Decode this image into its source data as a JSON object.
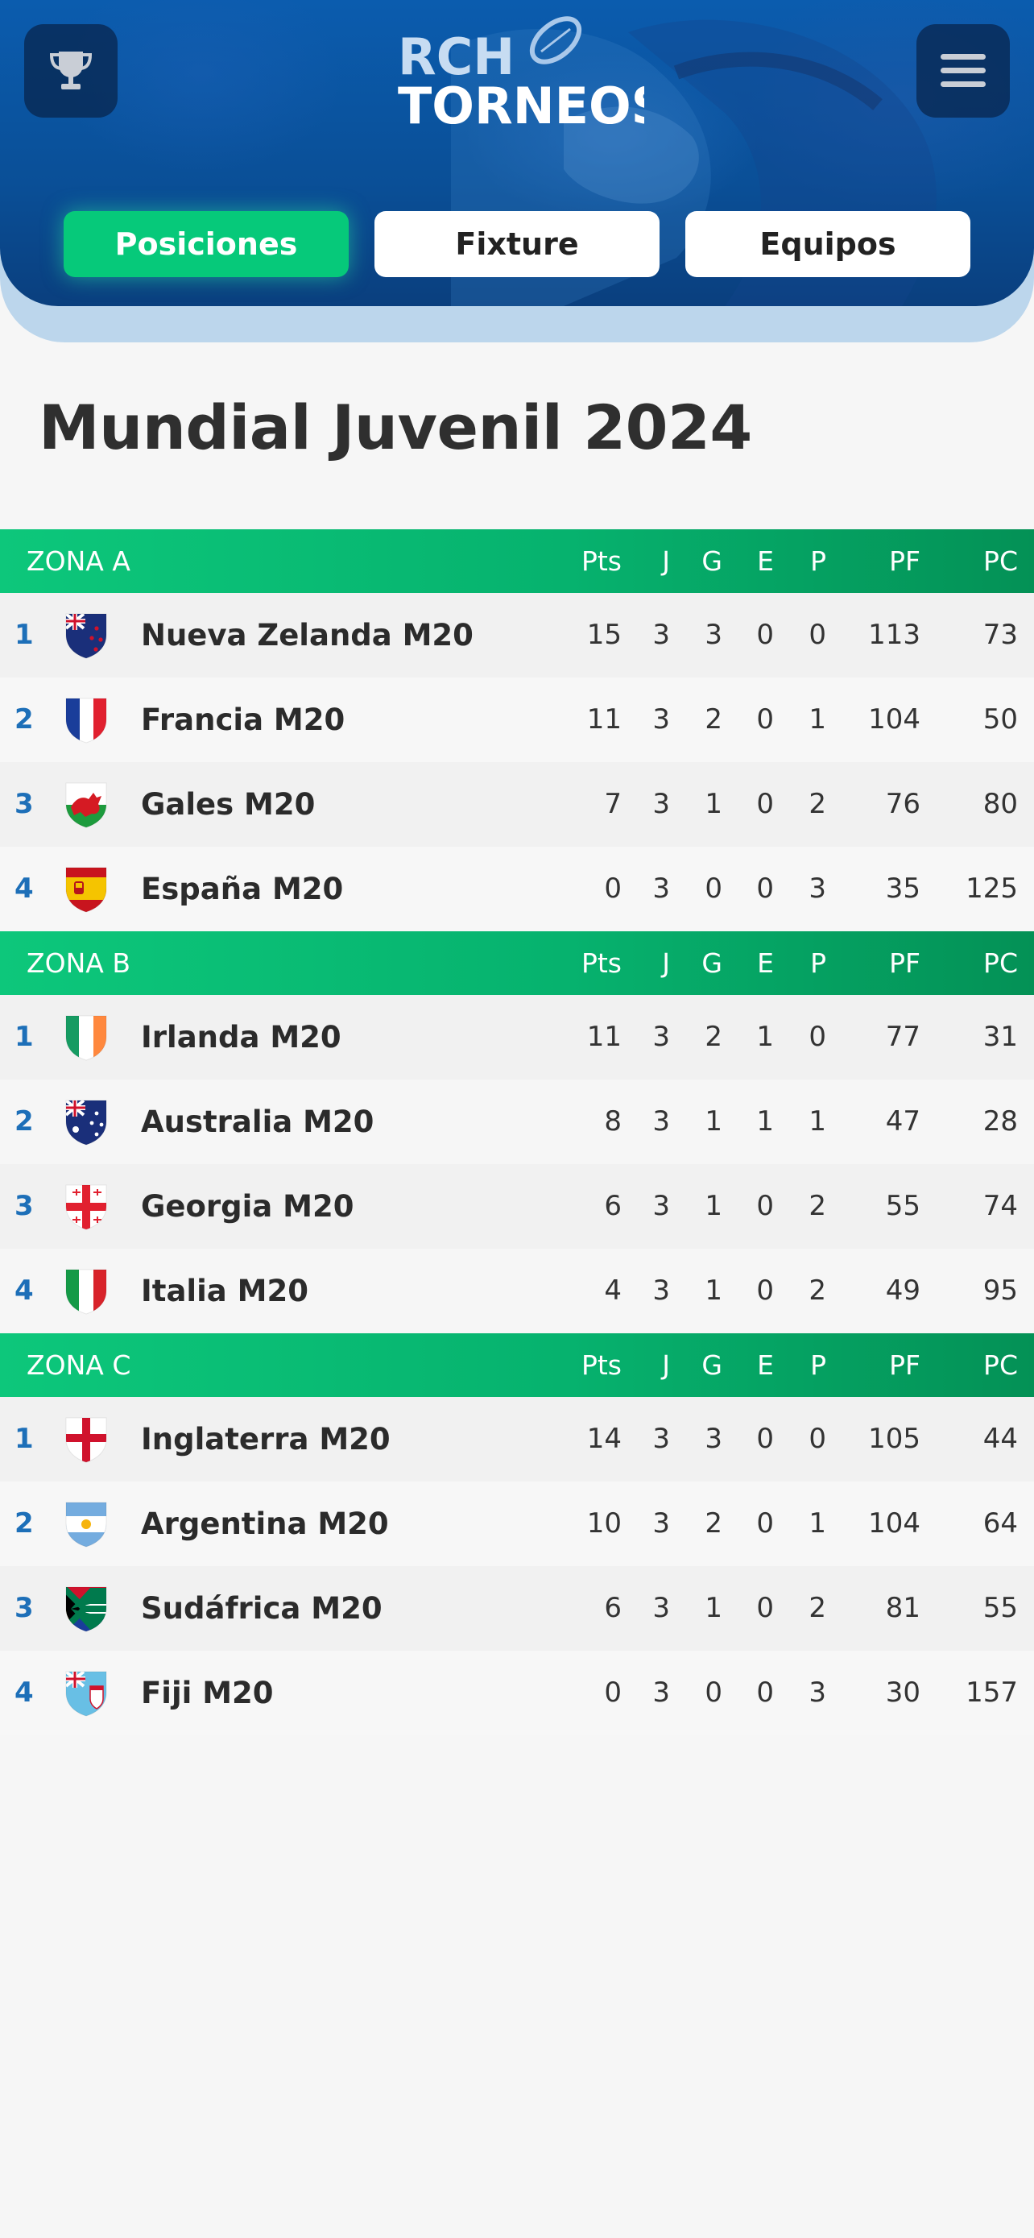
{
  "app": {
    "logo_line1": "RCH",
    "logo_line2": "TORNEOS",
    "icons": {
      "left": "trophy-icon",
      "right": "hamburger-menu-icon"
    }
  },
  "tabs": [
    {
      "label": "Posiciones",
      "active": true
    },
    {
      "label": "Fixture",
      "active": false
    },
    {
      "label": "Equipos",
      "active": false
    }
  ],
  "page": {
    "title": "Mundial Juvenil 2024"
  },
  "colors": {
    "brand_blue": "#0b5cae",
    "accent_green": "#06c97a",
    "position_blue": "#1d6fb8"
  },
  "columns": [
    "Pts",
    "J",
    "G",
    "E",
    "P",
    "PF",
    "PC"
  ],
  "zones": [
    {
      "name": "ZONA A",
      "teams": [
        {
          "pos": "1",
          "flag": "new-zealand-flag-icon",
          "team": "Nueva Zelanda M20",
          "pts": "15",
          "j": "3",
          "g": "3",
          "e": "0",
          "p": "0",
          "pf": "113",
          "pc": "73"
        },
        {
          "pos": "2",
          "flag": "france-flag-icon",
          "team": "Francia M20",
          "pts": "11",
          "j": "3",
          "g": "2",
          "e": "0",
          "p": "1",
          "pf": "104",
          "pc": "50"
        },
        {
          "pos": "3",
          "flag": "wales-flag-icon",
          "team": "Gales M20",
          "pts": "7",
          "j": "3",
          "g": "1",
          "e": "0",
          "p": "2",
          "pf": "76",
          "pc": "80"
        },
        {
          "pos": "4",
          "flag": "spain-flag-icon",
          "team": "España M20",
          "pts": "0",
          "j": "3",
          "g": "0",
          "e": "0",
          "p": "3",
          "pf": "35",
          "pc": "125"
        }
      ]
    },
    {
      "name": "ZONA B",
      "teams": [
        {
          "pos": "1",
          "flag": "ireland-flag-icon",
          "team": "Irlanda M20",
          "pts": "11",
          "j": "3",
          "g": "2",
          "e": "1",
          "p": "0",
          "pf": "77",
          "pc": "31"
        },
        {
          "pos": "2",
          "flag": "australia-flag-icon",
          "team": "Australia M20",
          "pts": "8",
          "j": "3",
          "g": "1",
          "e": "1",
          "p": "1",
          "pf": "47",
          "pc": "28"
        },
        {
          "pos": "3",
          "flag": "georgia-flag-icon",
          "team": "Georgia M20",
          "pts": "6",
          "j": "3",
          "g": "1",
          "e": "0",
          "p": "2",
          "pf": "55",
          "pc": "74"
        },
        {
          "pos": "4",
          "flag": "italy-flag-icon",
          "team": "Italia M20",
          "pts": "4",
          "j": "3",
          "g": "1",
          "e": "0",
          "p": "2",
          "pf": "49",
          "pc": "95"
        }
      ]
    },
    {
      "name": "ZONA C",
      "teams": [
        {
          "pos": "1",
          "flag": "england-flag-icon",
          "team": "Inglaterra M20",
          "pts": "14",
          "j": "3",
          "g": "3",
          "e": "0",
          "p": "0",
          "pf": "105",
          "pc": "44"
        },
        {
          "pos": "2",
          "flag": "argentina-flag-icon",
          "team": "Argentina M20",
          "pts": "10",
          "j": "3",
          "g": "2",
          "e": "0",
          "p": "1",
          "pf": "104",
          "pc": "64"
        },
        {
          "pos": "3",
          "flag": "south-africa-flag-icon",
          "team": "Sudáfrica M20",
          "pts": "6",
          "j": "3",
          "g": "1",
          "e": "0",
          "p": "2",
          "pf": "81",
          "pc": "55"
        },
        {
          "pos": "4",
          "flag": "fiji-flag-icon",
          "team": "Fiji M20",
          "pts": "0",
          "j": "3",
          "g": "0",
          "e": "0",
          "p": "3",
          "pf": "30",
          "pc": "157"
        }
      ]
    }
  ]
}
